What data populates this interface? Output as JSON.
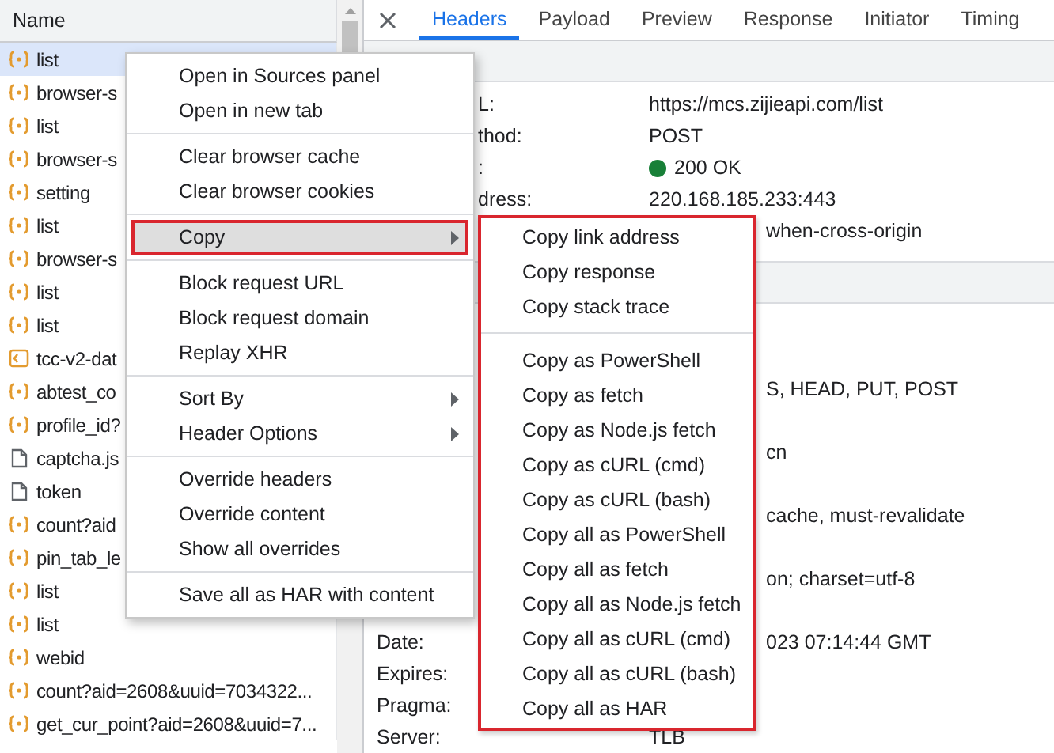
{
  "request_list": {
    "header": "Name",
    "rows": [
      {
        "name": "list",
        "kind": "xhr",
        "selected": true
      },
      {
        "name": "browser-s",
        "kind": "xhr",
        "selected": false
      },
      {
        "name": "list",
        "kind": "xhr",
        "selected": false
      },
      {
        "name": "browser-s",
        "kind": "xhr",
        "selected": false
      },
      {
        "name": "setting",
        "kind": "xhr",
        "selected": false
      },
      {
        "name": "list",
        "kind": "xhr",
        "selected": false
      },
      {
        "name": "browser-s",
        "kind": "xhr",
        "selected": false
      },
      {
        "name": "list",
        "kind": "xhr",
        "selected": false
      },
      {
        "name": "list",
        "kind": "xhr",
        "selected": false
      },
      {
        "name": "tcc-v2-dat",
        "kind": "script",
        "selected": false
      },
      {
        "name": "abtest_co",
        "kind": "xhr",
        "selected": false
      },
      {
        "name": "profile_id?",
        "kind": "xhr",
        "selected": false
      },
      {
        "name": "captcha.js",
        "kind": "doc",
        "selected": false
      },
      {
        "name": "token",
        "kind": "doc",
        "selected": false
      },
      {
        "name": "count?aid",
        "kind": "xhr",
        "selected": false
      },
      {
        "name": "pin_tab_le",
        "kind": "xhr",
        "selected": false
      },
      {
        "name": "list",
        "kind": "xhr",
        "selected": false
      },
      {
        "name": "list",
        "kind": "xhr",
        "selected": false
      },
      {
        "name": "webid",
        "kind": "xhr",
        "selected": false
      },
      {
        "name": "count?aid=2608&uuid=7034322...",
        "kind": "xhr",
        "selected": false
      },
      {
        "name": "get_cur_point?aid=2608&uuid=7...",
        "kind": "xhr",
        "selected": false
      }
    ]
  },
  "detail": {
    "tabs": [
      {
        "label": "Headers",
        "selected": true
      },
      {
        "label": "Payload",
        "selected": false
      },
      {
        "label": "Preview",
        "selected": false
      },
      {
        "label": "Response",
        "selected": false
      },
      {
        "label": "Initiator",
        "selected": false
      },
      {
        "label": "Timing",
        "selected": false
      }
    ],
    "general": [
      {
        "label": "L:",
        "value": "https://mcs.zijieapi.com/list"
      },
      {
        "label": "thod:",
        "value": "POST"
      },
      {
        "label": ":",
        "value": "200 OK",
        "kind": "status"
      },
      {
        "label": "dress:",
        "value": "220.168.185.233:443"
      },
      {
        "value": "when-cross-origin",
        "value_clipped": true
      }
    ],
    "response_headers": [
      {
        "value": "S, HEAD, PUT, POST",
        "value_clipped": true
      },
      {
        "value": "cn",
        "value_clipped": true,
        "gap_before": true
      },
      {
        "value": "cache, must-revalidate",
        "value_clipped": true,
        "gap_before": true
      },
      {
        "value": "on; charset=utf-8",
        "value_clipped": true,
        "gap_before": true
      },
      {
        "label": "Date:",
        "value": "023 07:14:44 GMT",
        "value_clipped": true,
        "gap_before": true
      },
      {
        "label": "Expires:"
      },
      {
        "label": "Pragma:"
      },
      {
        "label": "Server:",
        "value": "TLB"
      }
    ]
  },
  "menu": {
    "items": [
      {
        "kind": "item",
        "label": "Open in Sources panel"
      },
      {
        "kind": "item",
        "label": "Open in new tab"
      },
      {
        "kind": "separator"
      },
      {
        "kind": "item",
        "label": "Clear browser cache"
      },
      {
        "kind": "item",
        "label": "Clear browser cookies"
      },
      {
        "kind": "separator"
      },
      {
        "kind": "item",
        "label": "Copy",
        "submenu": true,
        "highlighted": true
      },
      {
        "kind": "separator"
      },
      {
        "kind": "item",
        "label": "Block request URL"
      },
      {
        "kind": "item",
        "label": "Block request domain"
      },
      {
        "kind": "item",
        "label": "Replay XHR"
      },
      {
        "kind": "separator"
      },
      {
        "kind": "item",
        "label": "Sort By",
        "submenu": true
      },
      {
        "kind": "item",
        "label": "Header Options",
        "submenu": true
      },
      {
        "kind": "separator"
      },
      {
        "kind": "item",
        "label": "Override headers"
      },
      {
        "kind": "item",
        "label": "Override content"
      },
      {
        "kind": "item",
        "label": "Show all overrides"
      },
      {
        "kind": "separator"
      },
      {
        "kind": "item",
        "label": "Save all as HAR with content"
      }
    ]
  },
  "submenu": {
    "highlighted": true,
    "items": [
      {
        "kind": "item",
        "label": "Copy link address"
      },
      {
        "kind": "item",
        "label": "Copy response"
      },
      {
        "kind": "item",
        "label": "Copy stack trace"
      },
      {
        "kind": "separator"
      },
      {
        "kind": "item",
        "label": "Copy as PowerShell"
      },
      {
        "kind": "item",
        "label": "Copy as fetch"
      },
      {
        "kind": "item",
        "label": "Copy as Node.js fetch"
      },
      {
        "kind": "item",
        "label": "Copy as cURL (cmd)"
      },
      {
        "kind": "item",
        "label": "Copy as cURL (bash)"
      },
      {
        "kind": "item",
        "label": "Copy all as PowerShell"
      },
      {
        "kind": "item",
        "label": "Copy all as fetch"
      },
      {
        "kind": "item",
        "label": "Copy all as Node.js fetch"
      },
      {
        "kind": "item",
        "label": "Copy all as cURL (cmd)"
      },
      {
        "kind": "item",
        "label": "Copy all as cURL (bash)"
      },
      {
        "kind": "item",
        "label": "Copy all as HAR"
      }
    ]
  }
}
